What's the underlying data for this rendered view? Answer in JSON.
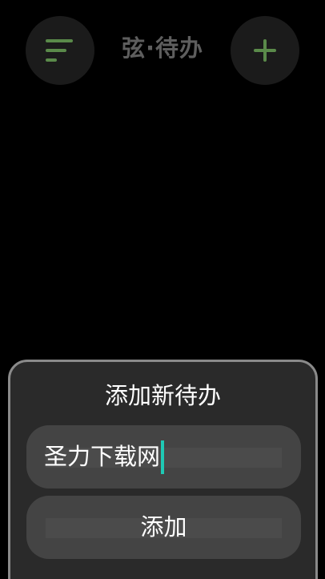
{
  "header": {
    "title": "弦·待办",
    "menu_icon": "menu-lines-icon",
    "add_icon": "plus-icon"
  },
  "dialog": {
    "title": "添加新待办",
    "input_value": "圣力下载网",
    "submit_label": "添加"
  },
  "colors": {
    "accent_green": "#5a8a4a",
    "cursor": "#1fc9b5",
    "sheet_bg": "#2a2a2a",
    "field_bg": "#444444",
    "title_gray": "#5e5e5e"
  }
}
